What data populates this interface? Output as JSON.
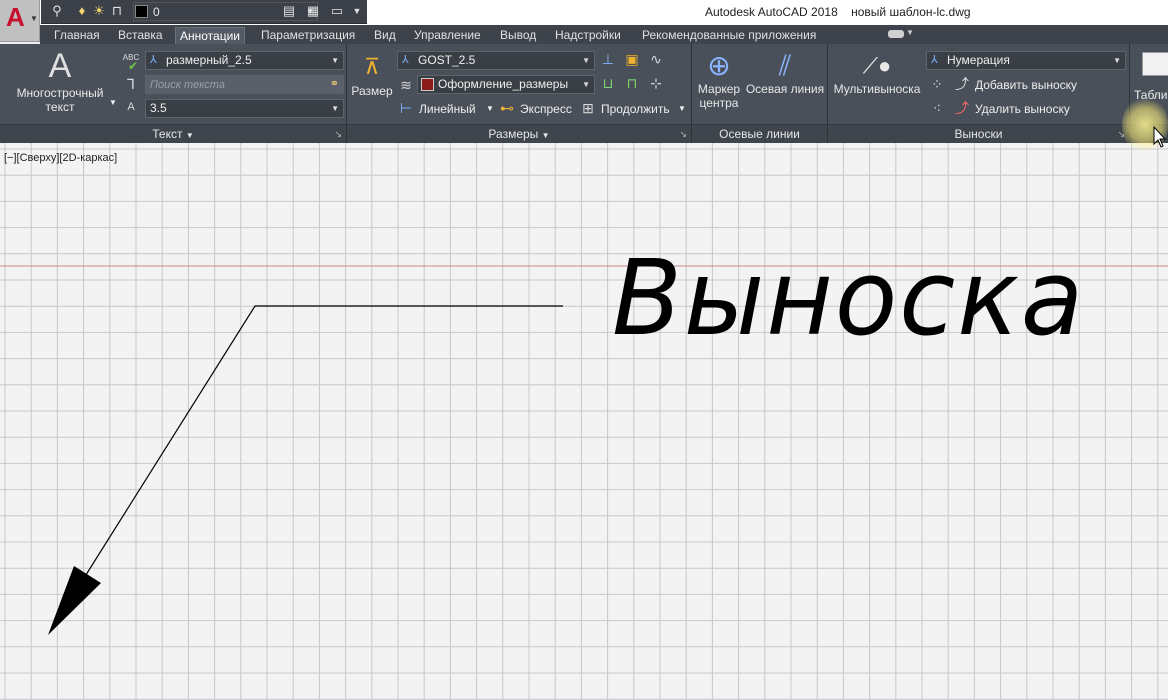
{
  "window": {
    "app_title": "Autodesk AutoCAD 2018",
    "file_name": "новый шаблон-lc.dwg"
  },
  "app_button": {
    "logo": "A"
  },
  "quick_access": {
    "layer_value": "0"
  },
  "tabs": [
    {
      "label": "Главная",
      "active": false
    },
    {
      "label": "Вставка",
      "active": false
    },
    {
      "label": "Аннотации",
      "active": true
    },
    {
      "label": "Параметризация",
      "active": false
    },
    {
      "label": "Вид",
      "active": false
    },
    {
      "label": "Управление",
      "active": false
    },
    {
      "label": "Вывод",
      "active": false
    },
    {
      "label": "Надстройки",
      "active": false
    },
    {
      "label": "Рекомендованные приложения",
      "active": false
    }
  ],
  "ribbon": {
    "text_panel": {
      "title": "Текст",
      "mtext_line1": "Многострочный",
      "mtext_line2": "текст",
      "style_value": "размерный_2.5",
      "search_placeholder": "Поиск текста",
      "height_value": "3.5",
      "abc_label": "ABC"
    },
    "dims_panel": {
      "title": "Размеры",
      "dim_button": "Размер",
      "dimstyle_value": "GOST_2.5",
      "layer_value": "Оформление_размеры",
      "linear": "Линейный",
      "express": "Экспресс",
      "continue": "Продолжить"
    },
    "center_panel": {
      "title": "Осевые линии",
      "center_mark_line1": "Маркер",
      "center_mark_line2": "центра",
      "centerline": "Осевая линия"
    },
    "leaders_panel": {
      "title": "Выноски",
      "multileader": "Мультивыноска",
      "style_value": "Нумерация",
      "add_leader": "Добавить выноску",
      "remove_leader": "Удалить выноску"
    },
    "table_panel": {
      "label": "Табли"
    }
  },
  "viewport": {
    "view_label": "[−][Сверху][2D-каркас]",
    "drawing_text": "Выноска"
  },
  "colors": {
    "layer_swatch": "#000000",
    "dim_layer_swatch": "#8b1a1a",
    "grid_line": "#c8c8cc",
    "axis_line": "#c78a8a"
  }
}
